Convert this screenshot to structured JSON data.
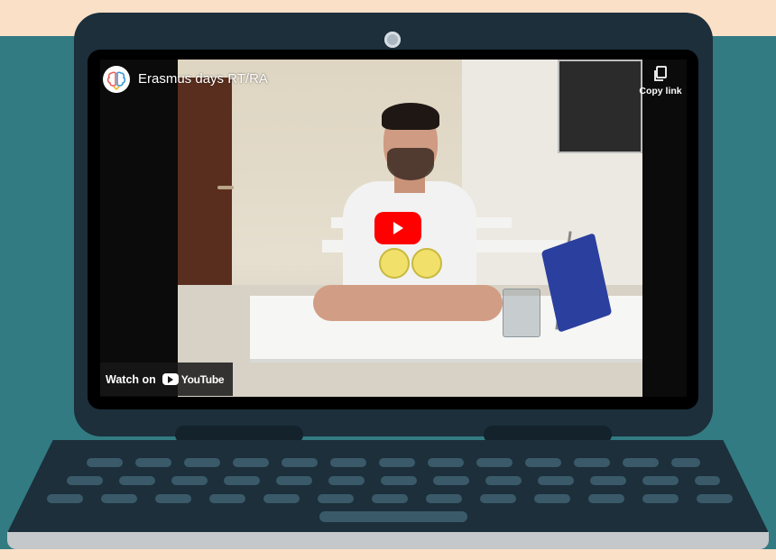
{
  "video": {
    "title": "Erasmus days RT/RA",
    "copy_link_label": "Copy link",
    "watch_on_label": "Watch on",
    "platform_name": "YouTube"
  },
  "colors": {
    "background_teal": "#327b82",
    "background_peach": "#fbe0c8",
    "laptop_body": "#1c2f3b",
    "key": "#3a5a69",
    "play_button_red": "#ff0000"
  },
  "icons": {
    "channel_avatar": "brain-logo-icon",
    "copy": "copy-icon",
    "play": "play-icon",
    "youtube": "youtube-logo-icon"
  }
}
